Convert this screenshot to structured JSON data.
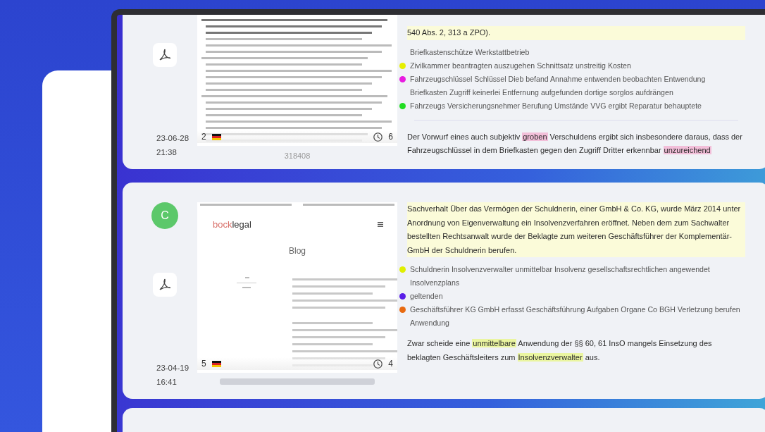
{
  "cards": [
    {
      "date": "23-06-28",
      "time": "21:38",
      "preview": {
        "kind": "document",
        "page_number": "2",
        "count": "6",
        "caption": "318408"
      },
      "blocks": [
        {
          "kind": "paragraph",
          "highlighted": true,
          "segments": [
            {
              "text": "540 Abs. 2, 313 a ZPO)."
            }
          ]
        },
        {
          "kind": "keywords",
          "items": [
            {
              "text": "Briefkastenschütze Werkstattbetrieb"
            },
            {
              "text": "Zivilkammer beantragten auszugehen Schnittsatz unstreitig Kosten",
              "color": "#e6ef00"
            },
            {
              "text": "Fahrzeugschlüssel Schlüssel Dieb befand Annahme entwenden beobachten Entwendung",
              "color": "#e81ce0"
            },
            {
              "text": "Briefkasten Zugriff keinerlei Entfernung aufgefunden dortige sorglos aufdrängen"
            },
            {
              "text": "Fahrzeugs Versicherungsnehmer Berufung Umstände VVG ergibt Reparatur behauptete",
              "color": "#22dd22"
            }
          ]
        },
        {
          "kind": "divider"
        },
        {
          "kind": "paragraph",
          "highlighted": false,
          "segments": [
            {
              "text": "Der Vorwurf eines auch subjektiv "
            },
            {
              "text": "groben",
              "color": "#f2bfd9"
            },
            {
              "text": " Verschuldens ergibt sich insbesondere daraus, dass der Fahrzeugschlüssel in dem Briefkasten gegen den Zugriff Dritter erkennbar "
            },
            {
              "text": "unzureichend",
              "color": "#f2bfd9"
            }
          ]
        }
      ]
    },
    {
      "avatar": {
        "letter": "C",
        "color": "#5cc86a"
      },
      "date": "23-04-19",
      "time": "16:41",
      "preview": {
        "kind": "webpage",
        "logo_part_1": "bock",
        "logo_part_2": "legal",
        "heading": "Blog",
        "page_number": "5",
        "count": "4"
      },
      "blocks": [
        {
          "kind": "paragraph",
          "highlighted": true,
          "segments": [
            {
              "text": "Sachverhalt Über das Vermögen der Schuldnerin, einer GmbH & Co. KG, wurde März 2014 unter Anordnung von Eigenverwaltung ein Insolvenzverfahren eröffnet. Neben dem zum Sachwalter bestellten Rechtsanwalt wurde der Beklagte zum weiteren Geschäftsführer der Komplementär-GmbH der Schuldnerin berufen."
            }
          ]
        },
        {
          "kind": "keywords",
          "items": [
            {
              "text": "Schuldnerin Insolvenzverwalter unmittelbar Insolvenz gesellschaftsrechtlichen angewendet Insolvenzplans",
              "color": "#e0ef00"
            },
            {
              "text": "geltenden",
              "color": "#5a1ee8"
            },
            {
              "text": "Geschäftsführer KG GmbH erfasst Geschäftsführung Aufgaben Organe Co BGH Verletzung berufen Anwendung",
              "color": "#e86a10"
            }
          ]
        },
        {
          "kind": "paragraph",
          "highlighted": false,
          "segments": [
            {
              "text": "Zwar scheide eine "
            },
            {
              "text": "unmittelbare",
              "color": "#eaf5a0"
            },
            {
              "text": " Anwendung der §§ 60, 61 InsO mangels Einsetzung des beklagten Geschäftsleiters zum "
            },
            {
              "text": "Insolvenzverwalter",
              "color": "#eaf5a0"
            },
            {
              "text": " aus."
            }
          ]
        }
      ]
    }
  ],
  "more_results_below": true
}
